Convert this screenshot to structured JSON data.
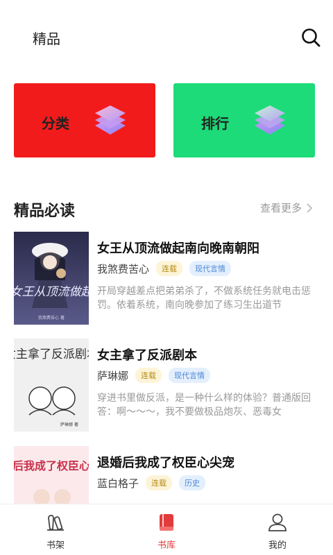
{
  "header": {
    "title": "精品"
  },
  "categories": [
    {
      "label": "分类",
      "color": "#f21b1b"
    },
    {
      "label": "排行",
      "color": "#1ddb78"
    }
  ],
  "section": {
    "title": "精品必读",
    "more": "查看更多"
  },
  "books": [
    {
      "title": "女王从顶流做起南向晚南朝阳",
      "author": "我煞费苦心",
      "status": "连载",
      "genre": "现代言情",
      "desc": "开局穿越差点把弟弟杀了，不做系统任务就电击惩罚。依着系统，南向晚参加了练习生出道节",
      "cover_text": "女王从顶流做起",
      "cover_author": "我煞费苦心 著"
    },
    {
      "title": "女主拿了反派剧本",
      "author": "萨琳娜",
      "status": "连载",
      "genre": "现代言情",
      "desc": "穿进书里做反派，是一种什么样的体验？普通版回答：啊～～～，我不要做极品炮灰、恶毒女",
      "cover_text": "女主拿了反派剧本",
      "cover_author": "萨琳娜 著"
    },
    {
      "title": "退婚后我成了权臣心尖宠",
      "author": "蓝白格子",
      "status": "连载",
      "genre": "历史",
      "desc": "",
      "cover_text": "退婚后我成了权臣心尖宠",
      "cover_author": ""
    }
  ],
  "tabs": [
    {
      "label": "书架",
      "active": false
    },
    {
      "label": "书库",
      "active": true
    },
    {
      "label": "我的",
      "active": false
    }
  ]
}
